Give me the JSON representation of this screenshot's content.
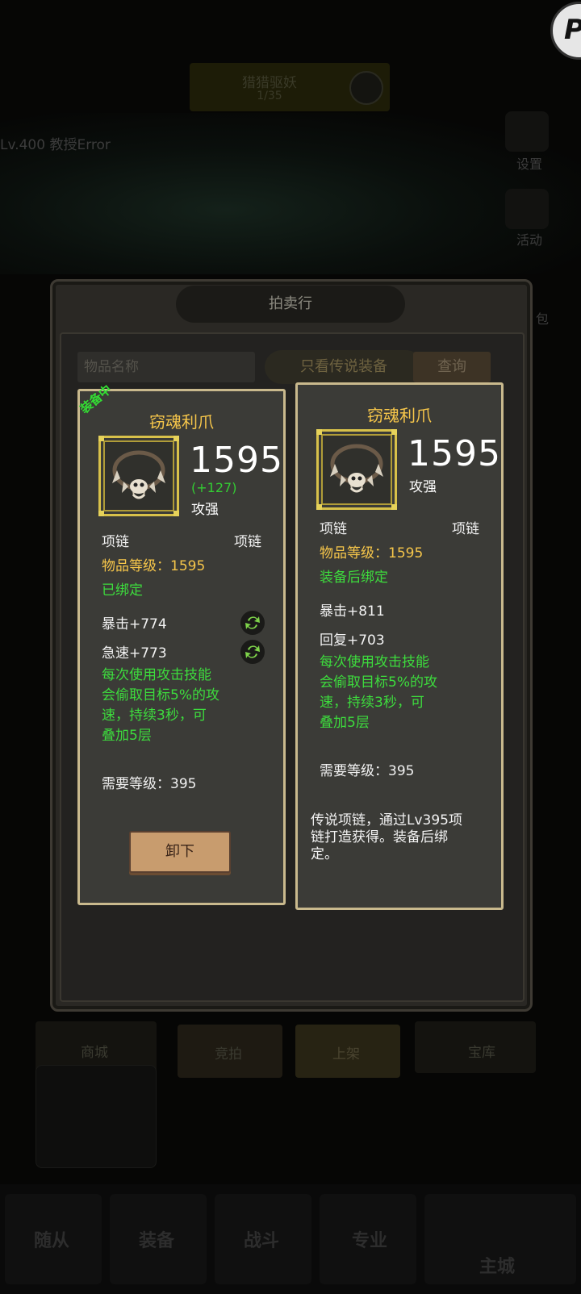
{
  "background": {
    "banner_line1": "猎猎驱妖",
    "banner_line2": "1/35",
    "player_info": "Lv.400 教授Error",
    "side_settings": "设置",
    "side_activity": "活动",
    "side_pack": "礼包",
    "shop": "商城",
    "treasury": "宝库",
    "tab_bid": "竞拍",
    "tab_list": "上架",
    "nav": [
      "随从",
      "装备",
      "战斗",
      "专业",
      "主城"
    ]
  },
  "dialog": {
    "title": "拍卖行",
    "search_placeholder": "物品名称",
    "legend_filter": "只看传说装备",
    "query_label": "查询"
  },
  "current_item": {
    "equipped_tag": "装备中",
    "name": "窃魂利爪",
    "power": "1595",
    "power_diff": "(+127)",
    "power_type": "攻强",
    "slot_left": "项链",
    "slot_right": "项链",
    "item_level": "物品等级：1595",
    "bind_status": "已绑定",
    "stat1": "暴击+774",
    "stat2": "急速+773",
    "effect_line1": "每次使用攻击技能",
    "effect_line2": "会偷取目标5%的攻",
    "effect_line3": "速，持续3秒，可",
    "effect_line4": "叠加5层",
    "required_level": "需要等级：395",
    "unequip_label": "卸下"
  },
  "compare_item": {
    "name": "窃魂利爪",
    "power": "1595",
    "power_type": "攻强",
    "slot_left": "项链",
    "slot_right": "项链",
    "item_level": "物品等级：1595",
    "bind_status": "装备后绑定",
    "stat1": "暴击+811",
    "stat2": "回复+703",
    "effect_line1": "每次使用攻击技能",
    "effect_line2": "会偷取目标5%的攻",
    "effect_line3": "速，持续3秒，可",
    "effect_line4": "叠加5层",
    "required_level": "需要等级：395",
    "lore_line1": "传说项链，通过Lv395项",
    "lore_line2": "链打造获得。装备后绑",
    "lore_line3": "定。"
  },
  "colors": {
    "gold_text": "#f6c64a",
    "green_text": "#3ddc3d",
    "card_bg": "#3b3b37",
    "card_border": "#c9b98d"
  }
}
